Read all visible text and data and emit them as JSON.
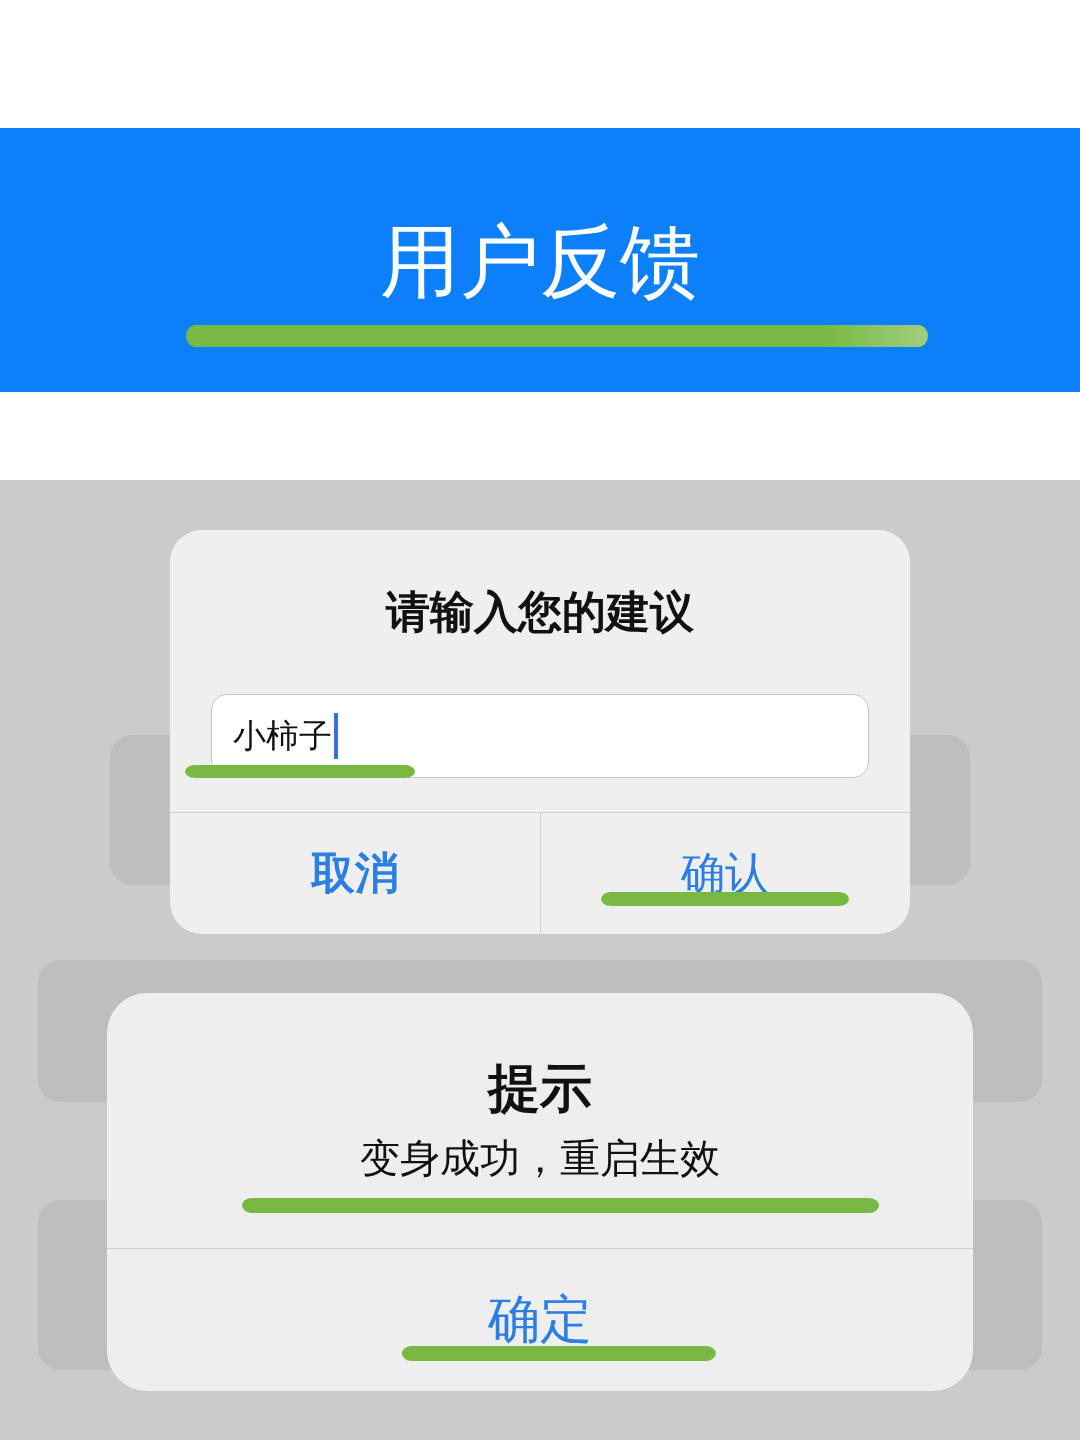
{
  "banner": {
    "title": "用户反馈",
    "highlighted": true
  },
  "input_dialog": {
    "title": "请输入您的建议",
    "field": {
      "value": "小柿子",
      "focused": true,
      "highlighted": true
    },
    "buttons": [
      {
        "label": "取消",
        "kind": "cancel",
        "highlighted": false
      },
      {
        "label": "确认",
        "kind": "confirm",
        "highlighted": true
      }
    ]
  },
  "alert_dialog": {
    "title": "提示",
    "message": {
      "text": "变身成功，重启生效",
      "highlighted": true
    },
    "buttons": [
      {
        "label": "确定",
        "highlighted": true
      }
    ]
  }
}
